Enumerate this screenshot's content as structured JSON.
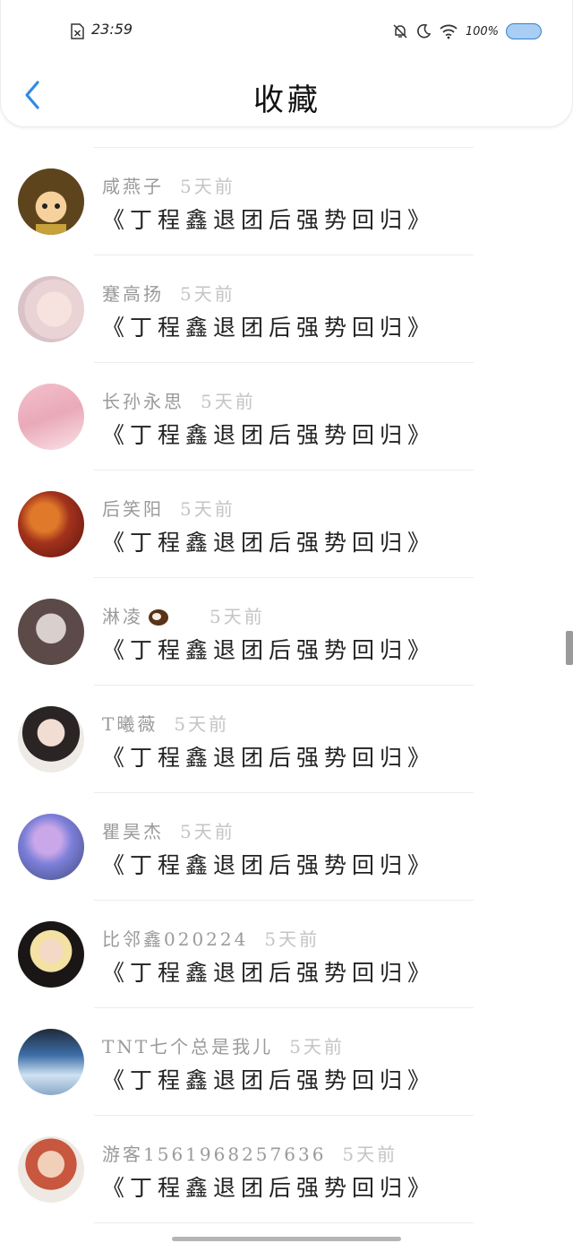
{
  "status": {
    "time": "23:59",
    "battery": "100%"
  },
  "nav": {
    "title": "收藏"
  },
  "items": [
    {
      "name": "咸燕子",
      "time": "5天前",
      "title": "《丁程鑫退团后强势回归》",
      "avatar": "avatar-cartoon-girl"
    },
    {
      "name": "蹇高扬",
      "time": "5天前",
      "title": "《丁程鑫退团后强势回归》",
      "avatar": "avatar-girl-portrait"
    },
    {
      "name": "长孙永思",
      "time": "5天前",
      "title": "《丁程鑫退团后强势回归》",
      "avatar": "avatar-pink-legs"
    },
    {
      "name": "后笑阳",
      "time": "5天前",
      "title": "《丁程鑫退团后强势回归》",
      "avatar": "avatar-autumn-leaves"
    },
    {
      "name": "淋凌",
      "time": "5天前",
      "title": "《丁程鑫退团后强势回归》",
      "avatar": "avatar-girl-cat",
      "emoji": "coconut-icon"
    },
    {
      "name": "T曦薇",
      "time": "5天前",
      "title": "《丁程鑫退团后强势回归》",
      "avatar": "avatar-girl-white-coat"
    },
    {
      "name": "瞿昊杰",
      "time": "5天前",
      "title": "《丁程鑫退团后强势回归》",
      "avatar": "avatar-betta-fish"
    },
    {
      "name": "比邻鑫020224",
      "time": "5天前",
      "title": "《丁程鑫退团后强势回归》",
      "avatar": "avatar-blonde-boy"
    },
    {
      "name": "TNT七个总是我儿",
      "time": "5天前",
      "title": "《丁程鑫退团后强势回归》",
      "avatar": "avatar-group-photo"
    },
    {
      "name": "游客1561968257636",
      "time": "5天前",
      "title": "《丁程鑫退团后强势回归》",
      "avatar": "avatar-boy-white-shirt"
    }
  ],
  "colors": {
    "accent": "#2f8be6",
    "name": "#9a9a9a",
    "time": "#c4c4c4",
    "title": "#222222"
  }
}
